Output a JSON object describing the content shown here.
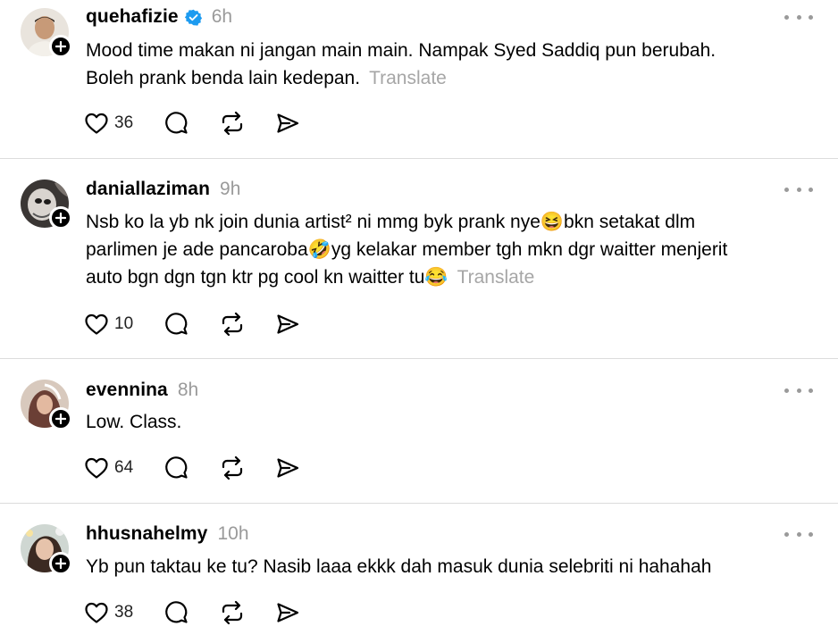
{
  "posts": [
    {
      "username": "quehafizie",
      "verified": true,
      "time": "6h",
      "text": "Mood time makan ni jangan main main. Nampak Syed Saddiq pun berubah.\nBoleh prank benda lain kedepan.",
      "translate": "Translate",
      "likes": "36"
    },
    {
      "username": "daniallaziman",
      "verified": false,
      "time": "9h",
      "text": "Nsb ko la yb nk join dunia artist² ni mmg byk prank nye😆bkn setakat dlm\nparlimen je ade pancaroba🤣yg kelakar member tgh mkn dgr waitter menjerit\nauto bgn dgn tgn ktr pg cool kn waitter tu😂",
      "translate": "Translate",
      "likes": "10"
    },
    {
      "username": "evennina",
      "verified": false,
      "time": "8h",
      "text": "Low. Class.",
      "translate": "",
      "likes": "64"
    },
    {
      "username": "hhusnahelmy",
      "verified": false,
      "time": "10h",
      "text": "Yb pun taktau ke tu? Nasib laaa ekkk dah masuk dunia selebriti ni hahahah",
      "translate": "",
      "likes": "38"
    }
  ],
  "icons": {
    "like": "heart-icon",
    "comment": "comment-icon",
    "repost": "repost-icon",
    "share": "share-icon",
    "more": "more-icon",
    "follow": "plus-icon",
    "verified": "verified-badge-icon"
  },
  "colors": {
    "verified": "#1d9bf0",
    "muted": "#9a9a9a",
    "divider": "#dcdcdc"
  }
}
